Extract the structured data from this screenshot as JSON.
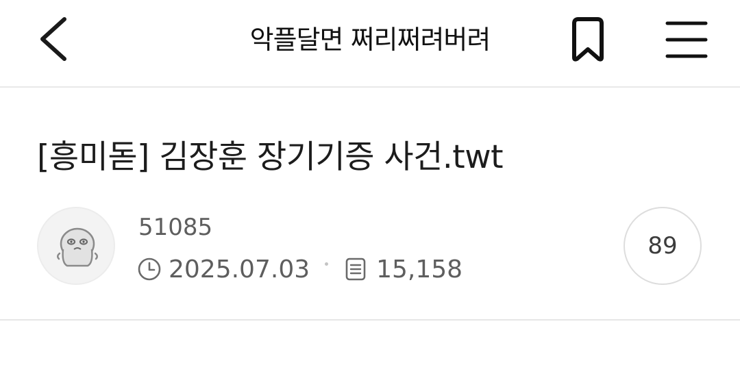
{
  "header": {
    "board_title": "악플달면 쩌리쩌려버려",
    "back_icon": "chevron-left-icon",
    "bookmark_icon": "bookmark-icon",
    "menu_icon": "hamburger-menu-icon"
  },
  "post": {
    "title": "[흥미돋] 김장훈 장기기증 사건.twt",
    "author": "51085",
    "date": "2025.07.03",
    "views": "15,158",
    "comment_count": "89",
    "date_icon": "clock-icon",
    "views_icon": "document-icon"
  },
  "colors": {
    "text_primary": "#1c1c1c",
    "text_secondary": "#5e5e5e",
    "divider": "#e6e6e6"
  }
}
